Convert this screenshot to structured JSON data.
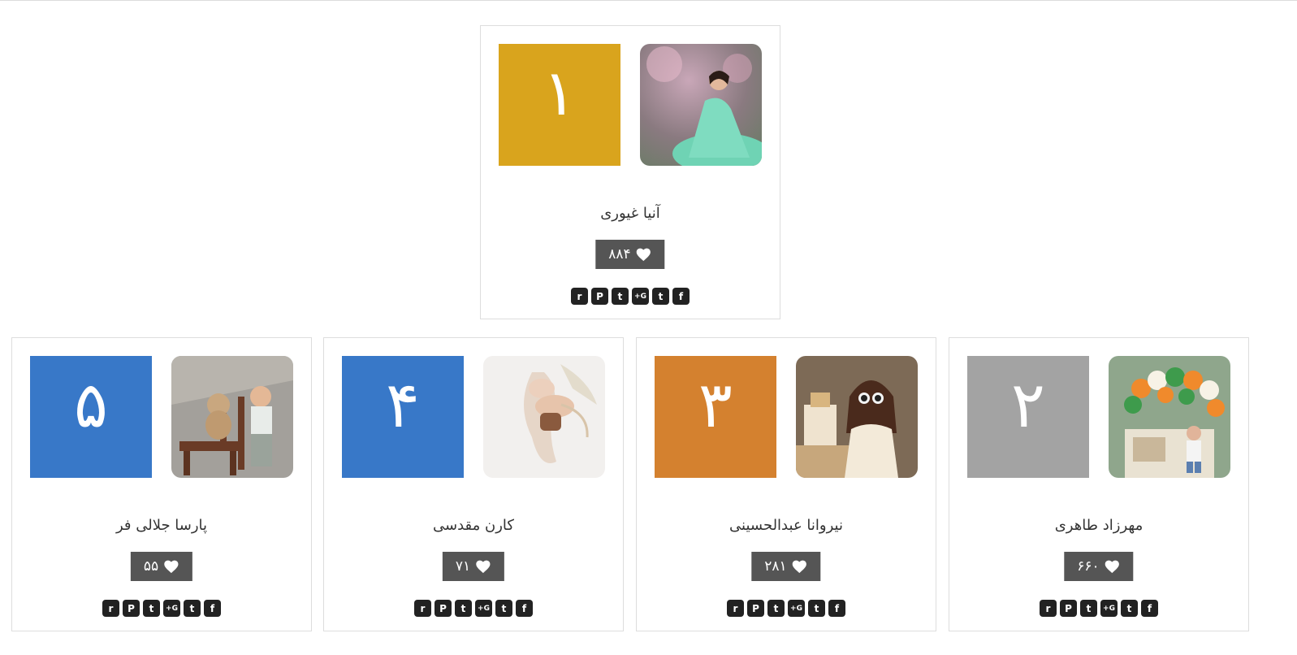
{
  "entries": [
    {
      "rank": "۱",
      "name": "آنیا غیوری",
      "likes": "۸۸۴",
      "rank_color": "#D9A41D",
      "photo": "girl-green-dress"
    },
    {
      "rank": "۲",
      "name": "مهرزاد طاهری",
      "likes": "۶۶۰",
      "rank_color": "#A3A3A3",
      "photo": "boy-balloons"
    },
    {
      "rank": "۳",
      "name": "نیروانا عبدالحسینی",
      "likes": "۲۸۱",
      "rank_color": "#D4812F",
      "photo": "girl-sunglasses"
    },
    {
      "rank": "۴",
      "name": "کارن مقدسی",
      "likes": "۷۱",
      "rank_color": "#3878C8",
      "photo": "newborn-sleeping"
    },
    {
      "rank": "۵",
      "name": "پارسا جلالی فر",
      "likes": "۵۵",
      "rank_color": "#3878C8",
      "photo": "boy-teddy-chair"
    }
  ],
  "share_icons": [
    {
      "icon": "facebook-icon",
      "glyph": "f"
    },
    {
      "icon": "twitter-icon",
      "glyph": "t"
    },
    {
      "icon": "google-plus-icon",
      "glyph": "G+"
    },
    {
      "icon": "tumblr-icon",
      "glyph": "t"
    },
    {
      "icon": "pinterest-icon",
      "glyph": "P"
    },
    {
      "icon": "reddit-icon",
      "glyph": "r"
    }
  ],
  "colors": {
    "likes_bg": "#555555",
    "border": "#dddddd"
  }
}
